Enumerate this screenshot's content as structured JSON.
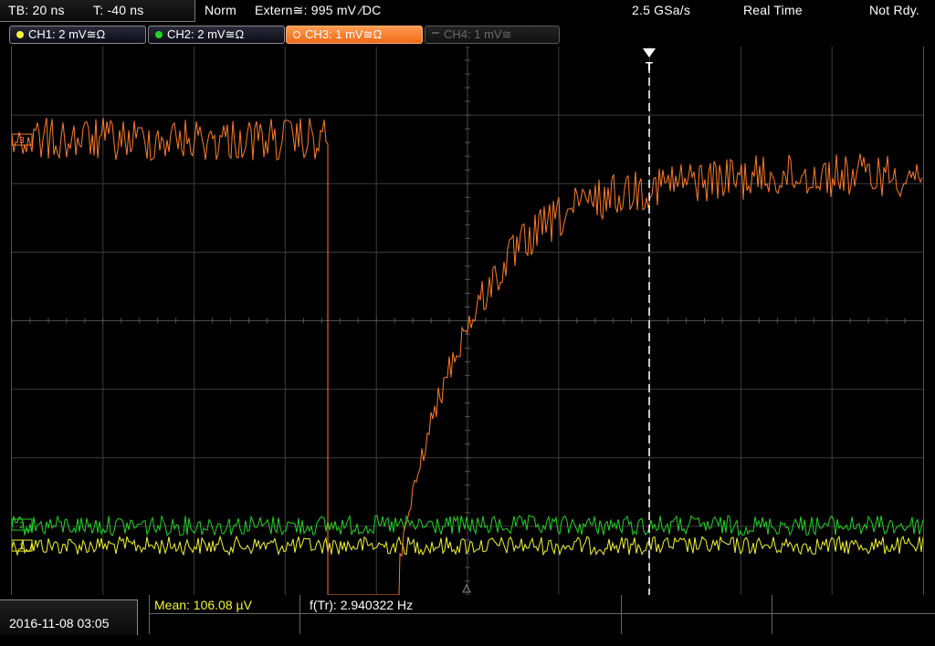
{
  "statusbar": {
    "timebase": "TB: 20 ns",
    "trigger_pos": "T: -40 ns",
    "mode": "Norm",
    "trigger_source": "Extern≅: 995 mV ∕DC",
    "sample_rate": "2.5 GSa/s",
    "acq_mode": "Real Time",
    "ready_state": "Not Rdy."
  },
  "channels": [
    {
      "label": "CH1: 2 mV≅Ω",
      "color": "#f4f436",
      "state": "on"
    },
    {
      "label": "CH2: 2 mV≅Ω",
      "color": "#22d422",
      "state": "on"
    },
    {
      "label": "CH3: 1 mV≅Ω",
      "color": "#ff7a2a",
      "state": "selected"
    },
    {
      "label": "CH4: 1 mV≅",
      "color": "#555555",
      "state": "off"
    }
  ],
  "markers": {
    "trigger": "T",
    "ch1": "1",
    "ch2": "2",
    "ch3": "3"
  },
  "measurements": {
    "mean": "Mean: 106.08 µV",
    "freq": "f(Tr): 2.940322 Hz"
  },
  "datetime": "2016-11-08 03:05",
  "colors": {
    "ch1": "#f4f436",
    "ch2": "#22d422",
    "ch3": "#ff7a2a",
    "grid": "#3c3c3c",
    "accent": "#ff7a2a"
  }
}
